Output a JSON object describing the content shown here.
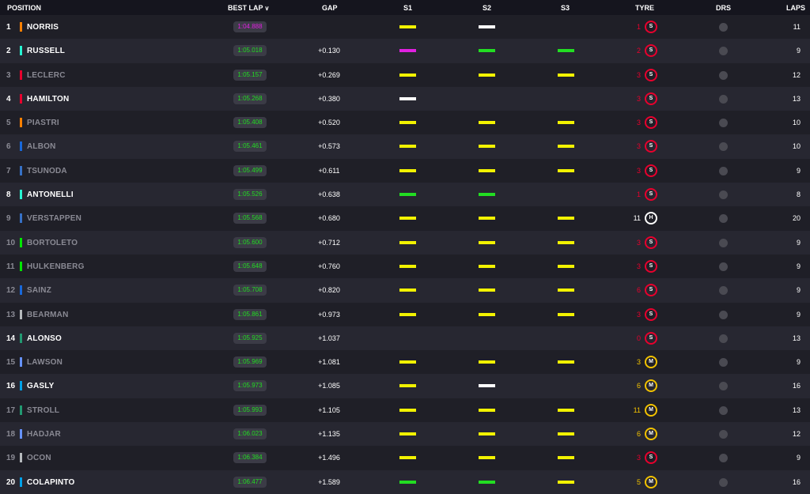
{
  "header": {
    "position": "POSITION",
    "best_lap": "BEST LAP",
    "gap": "GAP",
    "s1": "S1",
    "s2": "S2",
    "s3": "S3",
    "tyre": "TYRE",
    "drs": "DRS",
    "laps": "LAPS"
  },
  "colors": {
    "purple": "#e020e0",
    "green": "#22dd22",
    "yellow": "#f2f200",
    "white": "#ffffff",
    "soft": "#e8002d",
    "medium": "#f2c200",
    "hard": "#ffffff"
  },
  "rows": [
    {
      "pos": "1",
      "name": "NORRIS",
      "team_color": "#ff8000",
      "best": "1:04.888",
      "best_color": "#e020e0",
      "gap": "",
      "s1": "yellow",
      "s2": "white",
      "s3": "",
      "tyre_laps": "1",
      "tyre": "S",
      "laps": "11",
      "dim": false
    },
    {
      "pos": "2",
      "name": "RUSSELL",
      "team_color": "#27f4d2",
      "best": "1:05.018",
      "best_color": "#22dd22",
      "gap": "+0.130",
      "s1": "purple",
      "s2": "green",
      "s3": "green",
      "tyre_laps": "2",
      "tyre": "S",
      "laps": "9",
      "dim": false
    },
    {
      "pos": "3",
      "name": "LECLERC",
      "team_color": "#e8002d",
      "best": "1:05.157",
      "best_color": "#22dd22",
      "gap": "+0.269",
      "s1": "yellow",
      "s2": "yellow",
      "s3": "yellow",
      "tyre_laps": "3",
      "tyre": "S",
      "laps": "12",
      "dim": true
    },
    {
      "pos": "4",
      "name": "HAMILTON",
      "team_color": "#e8002d",
      "best": "1:05.268",
      "best_color": "#22dd22",
      "gap": "+0.380",
      "s1": "white",
      "s2": "",
      "s3": "",
      "tyre_laps": "3",
      "tyre": "S",
      "laps": "13",
      "dim": false
    },
    {
      "pos": "5",
      "name": "PIASTRI",
      "team_color": "#ff8000",
      "best": "1:05.408",
      "best_color": "#22dd22",
      "gap": "+0.520",
      "s1": "yellow",
      "s2": "yellow",
      "s3": "yellow",
      "tyre_laps": "3",
      "tyre": "S",
      "laps": "10",
      "dim": true
    },
    {
      "pos": "6",
      "name": "ALBON",
      "team_color": "#1868db",
      "best": "1:05.461",
      "best_color": "#22dd22",
      "gap": "+0.573",
      "s1": "yellow",
      "s2": "yellow",
      "s3": "yellow",
      "tyre_laps": "3",
      "tyre": "S",
      "laps": "10",
      "dim": true
    },
    {
      "pos": "7",
      "name": "TSUNODA",
      "team_color": "#3671c6",
      "best": "1:05.499",
      "best_color": "#22dd22",
      "gap": "+0.611",
      "s1": "yellow",
      "s2": "yellow",
      "s3": "yellow",
      "tyre_laps": "3",
      "tyre": "S",
      "laps": "9",
      "dim": true
    },
    {
      "pos": "8",
      "name": "ANTONELLI",
      "team_color": "#27f4d2",
      "best": "1:05.526",
      "best_color": "#22dd22",
      "gap": "+0.638",
      "s1": "green",
      "s2": "green",
      "s3": "",
      "tyre_laps": "1",
      "tyre": "S",
      "laps": "8",
      "dim": false
    },
    {
      "pos": "9",
      "name": "VERSTAPPEN",
      "team_color": "#3671c6",
      "best": "1:05.568",
      "best_color": "#22dd22",
      "gap": "+0.680",
      "s1": "yellow",
      "s2": "yellow",
      "s3": "yellow",
      "tyre_laps": "11",
      "tyre": "H",
      "laps": "20",
      "dim": true
    },
    {
      "pos": "10",
      "name": "BORTOLETO",
      "team_color": "#00e701",
      "best": "1:05.600",
      "best_color": "#22dd22",
      "gap": "+0.712",
      "s1": "yellow",
      "s2": "yellow",
      "s3": "yellow",
      "tyre_laps": "3",
      "tyre": "S",
      "laps": "9",
      "dim": true
    },
    {
      "pos": "11",
      "name": "HULKENBERG",
      "team_color": "#00e701",
      "best": "1:05.648",
      "best_color": "#22dd22",
      "gap": "+0.760",
      "s1": "yellow",
      "s2": "yellow",
      "s3": "yellow",
      "tyre_laps": "3",
      "tyre": "S",
      "laps": "9",
      "dim": true
    },
    {
      "pos": "12",
      "name": "SAINZ",
      "team_color": "#1868db",
      "best": "1:05.708",
      "best_color": "#22dd22",
      "gap": "+0.820",
      "s1": "yellow",
      "s2": "yellow",
      "s3": "yellow",
      "tyre_laps": "6",
      "tyre": "S",
      "laps": "9",
      "dim": true
    },
    {
      "pos": "13",
      "name": "BEARMAN",
      "team_color": "#b6babd",
      "best": "1:05.861",
      "best_color": "#22dd22",
      "gap": "+0.973",
      "s1": "yellow",
      "s2": "yellow",
      "s3": "yellow",
      "tyre_laps": "3",
      "tyre": "S",
      "laps": "9",
      "dim": true
    },
    {
      "pos": "14",
      "name": "ALONSO",
      "team_color": "#229971",
      "best": "1:05.925",
      "best_color": "#22dd22",
      "gap": "+1.037",
      "s1": "",
      "s2": "",
      "s3": "",
      "tyre_laps": "0",
      "tyre": "S",
      "laps": "13",
      "dim": false
    },
    {
      "pos": "15",
      "name": "LAWSON",
      "team_color": "#6692ff",
      "best": "1:05.969",
      "best_color": "#22dd22",
      "gap": "+1.081",
      "s1": "yellow",
      "s2": "yellow",
      "s3": "yellow",
      "tyre_laps": "3",
      "tyre": "M",
      "laps": "9",
      "dim": true
    },
    {
      "pos": "16",
      "name": "GASLY",
      "team_color": "#00a1e8",
      "best": "1:05.973",
      "best_color": "#22dd22",
      "gap": "+1.085",
      "s1": "yellow",
      "s2": "white",
      "s3": "",
      "tyre_laps": "6",
      "tyre": "M",
      "laps": "16",
      "dim": false
    },
    {
      "pos": "17",
      "name": "STROLL",
      "team_color": "#229971",
      "best": "1:05.993",
      "best_color": "#22dd22",
      "gap": "+1.105",
      "s1": "yellow",
      "s2": "yellow",
      "s3": "yellow",
      "tyre_laps": "11",
      "tyre": "M",
      "laps": "13",
      "dim": true
    },
    {
      "pos": "18",
      "name": "HADJAR",
      "team_color": "#6692ff",
      "best": "1:06.023",
      "best_color": "#22dd22",
      "gap": "+1.135",
      "s1": "yellow",
      "s2": "yellow",
      "s3": "yellow",
      "tyre_laps": "6",
      "tyre": "M",
      "laps": "12",
      "dim": true
    },
    {
      "pos": "19",
      "name": "OCON",
      "team_color": "#b6babd",
      "best": "1:06.384",
      "best_color": "#22dd22",
      "gap": "+1.496",
      "s1": "yellow",
      "s2": "yellow",
      "s3": "yellow",
      "tyre_laps": "3",
      "tyre": "S",
      "laps": "9",
      "dim": true
    },
    {
      "pos": "20",
      "name": "COLAPINTO",
      "team_color": "#00a1e8",
      "best": "1:06.477",
      "best_color": "#22dd22",
      "gap": "+1.589",
      "s1": "green",
      "s2": "green",
      "s3": "yellow",
      "tyre_laps": "5",
      "tyre": "M",
      "laps": "16",
      "dim": false
    }
  ]
}
